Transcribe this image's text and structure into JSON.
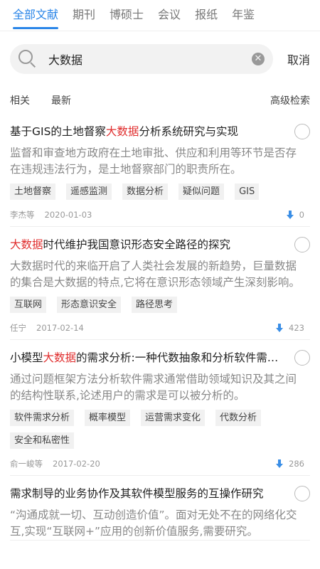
{
  "tabs": [
    {
      "label": "全部文献",
      "active": true
    },
    {
      "label": "期刊",
      "active": false
    },
    {
      "label": "博硕士",
      "active": false
    },
    {
      "label": "会议",
      "active": false
    },
    {
      "label": "报纸",
      "active": false
    },
    {
      "label": "年鉴",
      "active": false
    }
  ],
  "search": {
    "query": "大数据",
    "cancel_label": "取消",
    "clear_icon": "clear-icon"
  },
  "sort": {
    "relevance": "相关",
    "newest": "最新",
    "advanced": "高级检索"
  },
  "colors": {
    "accent": "#2b86e8",
    "highlight": "#e02d2d"
  },
  "results": [
    {
      "title_pre": "基于GIS的土地督察",
      "title_hl": "大数据",
      "title_post": "分析系统研究与实现",
      "abstract": "监督和审查地方政府在土地审批、供应和利用等环节是否存在违规违法行为，是土地督察部门的职责所在。",
      "tags": [
        "土地督察",
        "遥感监测",
        "数据分析",
        "疑似问题",
        "GIS"
      ],
      "author": "李杰等",
      "date": "2020-01-03",
      "downloads": "0"
    },
    {
      "title_pre": "",
      "title_hl": "大数据",
      "title_post": "时代维护我国意识形态安全路径的探究",
      "abstract": "大数据时代的来临开启了人类社会发展的新趋势，巨量数据的集合是大数据的特点,它将在意识形态领域产生深刻影响。",
      "tags": [
        "互联网",
        "形态意识安全",
        "路径思考"
      ],
      "author": "任宁",
      "date": "2017-02-14",
      "downloads": "423"
    },
    {
      "title_pre": "小模型",
      "title_hl": "大数据",
      "title_post": "的需求分析:一种代数抽象和分析软件需求的方法",
      "abstract": "通过问题框架方法分析软件需求通常借助领域知识及其之间的结构性联系,论述用户的需求是可以被分析的。",
      "tags": [
        "软件需求分析",
        "概率模型",
        "运营需求变化",
        "代数分析",
        "安全和私密性"
      ],
      "author": "俞一峻等",
      "date": "2017-02-20",
      "downloads": "286"
    },
    {
      "title_pre": "需求制导的业务协作及其软件模型服务的互操作研究",
      "title_hl": "",
      "title_post": "",
      "abstract": "“沟通成就一切、互动创造价值”。面对无处不在的网络化交互,实现“互联网+”应用的创新价值服务,需要研究。",
      "tags": [],
      "author": "",
      "date": "",
      "downloads": ""
    }
  ]
}
